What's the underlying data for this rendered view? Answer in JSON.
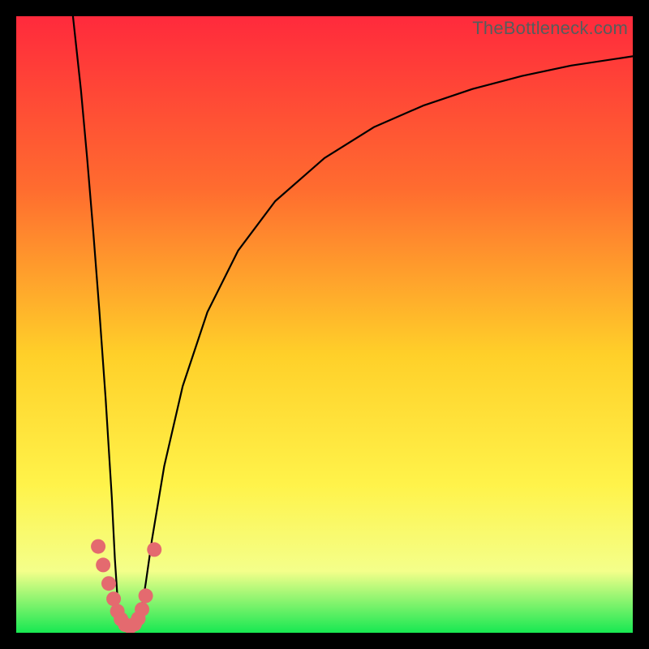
{
  "attribution": "TheBottleneck.com",
  "colors": {
    "background_frame": "#000000",
    "gradient_top": "#ff2a3c",
    "gradient_mid1": "#ff6c2f",
    "gradient_mid2": "#ffd029",
    "gradient_mid3": "#fff34a",
    "gradient_mid4": "#f4ff8a",
    "gradient_bottom": "#17e852",
    "curve": "#000000",
    "marker": "#e46a6f"
  },
  "chart_data": {
    "type": "line",
    "title": "",
    "xlabel": "",
    "ylabel": "",
    "xlim": [
      0,
      100
    ],
    "ylim": [
      0,
      100
    ],
    "series": [
      {
        "name": "left-branch",
        "x": [
          9.2,
          10.5,
          11.5,
          12.5,
          13.5,
          14.5,
          15.5,
          16.0,
          16.6
        ],
        "y": [
          100,
          88,
          77,
          65,
          52,
          38,
          22,
          12,
          3
        ]
      },
      {
        "name": "valley",
        "x": [
          16.6,
          17.2,
          18.0,
          18.8,
          19.5,
          20.2
        ],
        "y": [
          3,
          1.2,
          0.8,
          0.9,
          1.5,
          3
        ]
      },
      {
        "name": "right-branch",
        "x": [
          20.2,
          21,
          22,
          24,
          27,
          31,
          36,
          42,
          50,
          58,
          66,
          74,
          82,
          90,
          100
        ],
        "y": [
          3,
          8,
          15,
          27,
          40,
          52,
          62,
          70,
          77,
          82,
          85.5,
          88.2,
          90.3,
          92,
          93.5
        ]
      }
    ],
    "markers": {
      "name": "highlighted-points",
      "x": [
        13.3,
        14.1,
        15.0,
        15.8,
        16.4,
        17.0,
        17.7,
        18.5,
        19.2,
        19.8,
        20.4,
        21.0,
        22.4
      ],
      "y": [
        14.0,
        11.0,
        8.0,
        5.5,
        3.5,
        2.2,
        1.3,
        1.0,
        1.4,
        2.3,
        3.8,
        6.0,
        13.5
      ]
    }
  }
}
